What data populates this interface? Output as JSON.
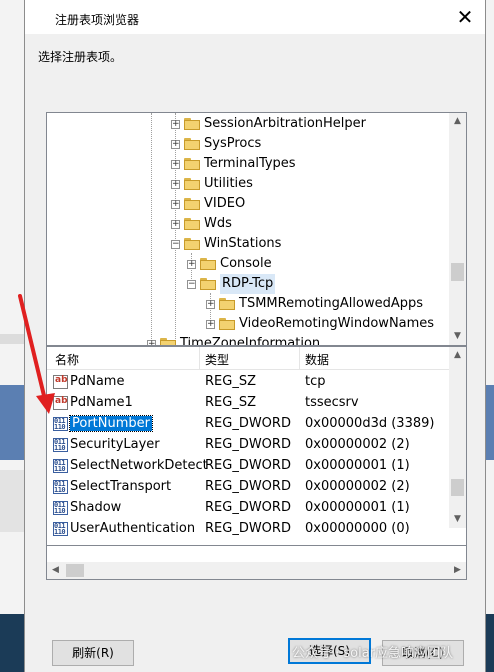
{
  "dialog": {
    "title": "注册表项浏览器",
    "prompt": "选择注册表项。",
    "close_glyph": "✕"
  },
  "tree": {
    "items": [
      {
        "label": "SessionArbitrationHelper",
        "expander": "+"
      },
      {
        "label": "SysProcs",
        "expander": "+"
      },
      {
        "label": "TerminalTypes",
        "expander": "+"
      },
      {
        "label": "Utilities",
        "expander": "+"
      },
      {
        "label": "VIDEO",
        "expander": "+"
      },
      {
        "label": "Wds",
        "expander": "+"
      },
      {
        "label": "WinStations",
        "expander": "−"
      },
      {
        "label": "Console",
        "expander": "+"
      },
      {
        "label": "RDP-Tcp",
        "expander": "−",
        "selected": true
      },
      {
        "label": "TSMMRemotingAllowedApps",
        "expander": "+"
      },
      {
        "label": "VideoRemotingWindowNames",
        "expander": "+"
      },
      {
        "label": "TimeZoneInformation",
        "expander": "+"
      }
    ]
  },
  "list": {
    "columns": {
      "name": "名称",
      "type": "类型",
      "data": "数据"
    },
    "rows": [
      {
        "name": "PdName",
        "type": "REG_SZ",
        "data": "tcp",
        "icon": "reg-sz-icon"
      },
      {
        "name": "PdName1",
        "type": "REG_SZ",
        "data": "tssecsrv",
        "icon": "reg-sz-icon"
      },
      {
        "name": "PortNumber",
        "type": "REG_DWORD",
        "data": "0x00000d3d (3389)",
        "icon": "reg-dword-icon",
        "selected": true
      },
      {
        "name": "SecurityLayer",
        "type": "REG_DWORD",
        "data": "0x00000002 (2)",
        "icon": "reg-dword-icon"
      },
      {
        "name": "SelectNetworkDetect",
        "type": "REG_DWORD",
        "data": "0x00000001 (1)",
        "icon": "reg-dword-icon"
      },
      {
        "name": "SelectTransport",
        "type": "REG_DWORD",
        "data": "0x00000002 (2)",
        "icon": "reg-dword-icon"
      },
      {
        "name": "Shadow",
        "type": "REG_DWORD",
        "data": "0x00000001 (1)",
        "icon": "reg-dword-icon"
      },
      {
        "name": "UserAuthentication",
        "type": "REG_DWORD",
        "data": "0x00000000 (0)",
        "icon": "reg-dword-icon"
      }
    ]
  },
  "buttons": {
    "refresh": "刷新(R)",
    "select": "选择(S)",
    "cancel": "取消(C)"
  },
  "watermark": "公众号 · solar应急响应团队",
  "colors": {
    "selection": "#0078d7",
    "annotation_arrow": "#e02020",
    "taskbar": "#1b3b57"
  }
}
